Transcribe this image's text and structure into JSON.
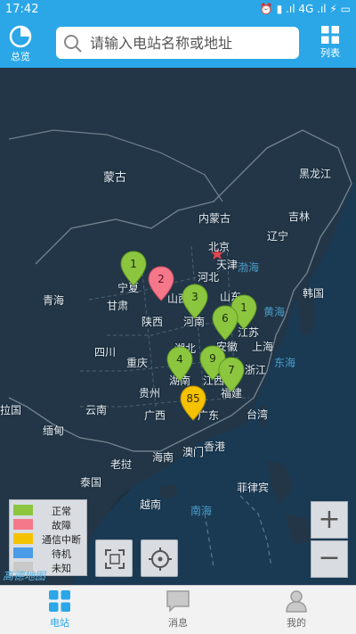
{
  "status_bar": {
    "time": "17:42",
    "right": "⏰ ▮ .ıl 4G .ıl ⚡ ▭"
  },
  "header": {
    "overview_label": "总览",
    "search_placeholder": "请输入电站名称或地址",
    "list_label": "列表"
  },
  "map": {
    "labels": [
      {
        "text": "蒙古",
        "size": "big"
      },
      {
        "text": "黑龙江"
      },
      {
        "text": "内蒙古"
      },
      {
        "text": "吉林"
      },
      {
        "text": "北京"
      },
      {
        "text": "天津"
      },
      {
        "text": "辽宁"
      },
      {
        "text": "河北"
      },
      {
        "text": "渤海",
        "sea": true
      },
      {
        "text": "宁夏"
      },
      {
        "text": "山西"
      },
      {
        "text": "山东"
      },
      {
        "text": "青海"
      },
      {
        "text": "甘肃"
      },
      {
        "text": "黄海",
        "sea": true
      },
      {
        "text": "韩国"
      },
      {
        "text": "陕西"
      },
      {
        "text": "河南"
      },
      {
        "text": "江苏"
      },
      {
        "text": "安徽"
      },
      {
        "text": "上海"
      },
      {
        "text": "四川"
      },
      {
        "text": "湖北"
      },
      {
        "text": "重庆"
      },
      {
        "text": "浙江"
      },
      {
        "text": "东海",
        "sea": true
      },
      {
        "text": "湖南"
      },
      {
        "text": "江西"
      },
      {
        "text": "贵州"
      },
      {
        "text": "福建"
      },
      {
        "text": "云南"
      },
      {
        "text": "广西"
      },
      {
        "text": "广东"
      },
      {
        "text": "台湾"
      },
      {
        "text": "拉国"
      },
      {
        "text": "缅甸"
      },
      {
        "text": "香港"
      },
      {
        "text": "澳门"
      },
      {
        "text": "海南"
      },
      {
        "text": "老挝"
      },
      {
        "text": "泰国"
      },
      {
        "text": "菲律宾"
      },
      {
        "text": "越南"
      },
      {
        "text": "南海",
        "sea": true
      }
    ],
    "markers": [
      {
        "num": "1",
        "status": "normal"
      },
      {
        "num": "2",
        "status": "fault"
      },
      {
        "num": "3",
        "status": "normal"
      },
      {
        "num": "1",
        "status": "normal"
      },
      {
        "num": "6",
        "status": "normal"
      },
      {
        "num": "4",
        "status": "normal"
      },
      {
        "num": "9",
        "status": "normal"
      },
      {
        "num": "7",
        "status": "normal"
      },
      {
        "num": "85",
        "status": "comm"
      }
    ],
    "watermark": "高德地图"
  },
  "legend": [
    {
      "label": "正常",
      "color": "#8cc63f"
    },
    {
      "label": "故障",
      "color": "#f4788a"
    },
    {
      "label": "通信中断",
      "color": "#f5c200"
    },
    {
      "label": "待机",
      "color": "#4a9be8"
    },
    {
      "label": "未知",
      "color": "#c9c9c9"
    }
  ],
  "controls": {
    "zoom_in": "+",
    "zoom_out": "−"
  },
  "nav": [
    {
      "label": "电站",
      "icon": "grid-icon",
      "active": true
    },
    {
      "label": "消息",
      "icon": "message-icon",
      "active": false
    },
    {
      "label": "我的",
      "icon": "user-icon",
      "active": false
    }
  ],
  "colors": {
    "accent": "#2ba7e8",
    "normal": "#8cc63f",
    "fault": "#f4788a",
    "comm": "#f5c200",
    "standby": "#4a9be8"
  }
}
